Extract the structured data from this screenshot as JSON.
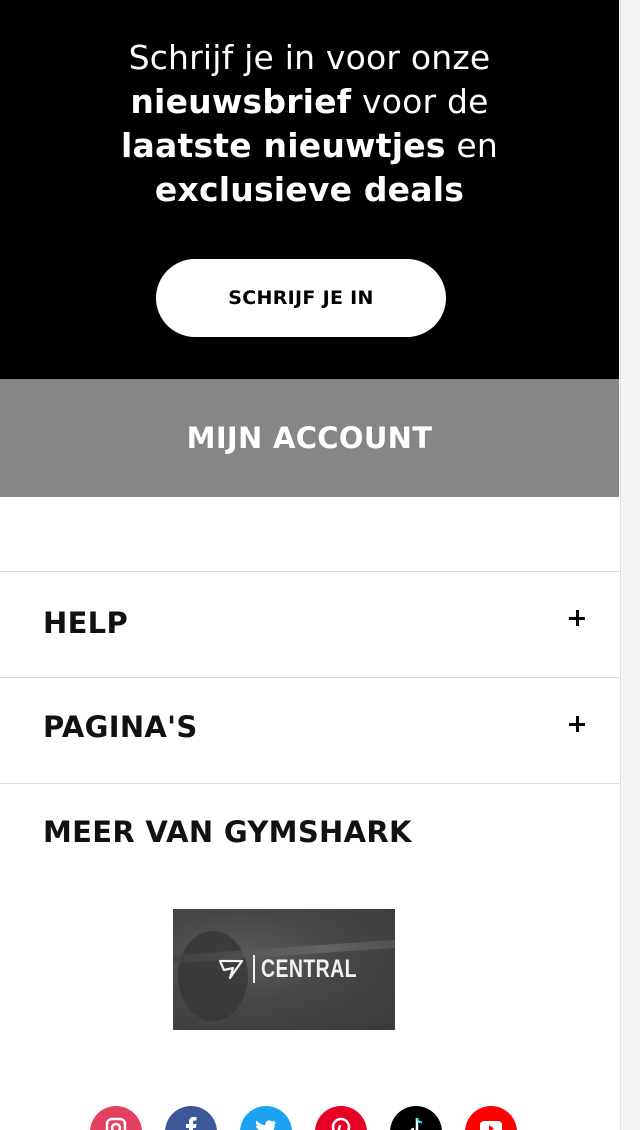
{
  "newsletter": {
    "line1": "Schrijf je in voor onze",
    "line2_bold": "nieuwsbrief",
    "line2_rest": " voor de",
    "line3_bold": "laatste nieuwtjes",
    "line3_rest": " en",
    "line4_bold": "exclusieve deals",
    "button_label": "SCHRIJF JE IN"
  },
  "account": {
    "label": "MIJN ACCOUNT"
  },
  "accordion": [
    {
      "label": "HELP",
      "icon": "plus-icon"
    },
    {
      "label": "PAGINA'S",
      "icon": "plus-icon"
    }
  ],
  "more": {
    "title": "MEER VAN GYMSHARK",
    "banner_text": "CENTRAL"
  },
  "social": [
    {
      "name": "instagram-icon",
      "color": "#e4405f"
    },
    {
      "name": "facebook-icon",
      "color": "#3b5998"
    },
    {
      "name": "twitter-icon",
      "color": "#1da1f2"
    },
    {
      "name": "pinterest-icon",
      "color": "#e60023"
    },
    {
      "name": "tiktok-icon",
      "color": "#000000"
    },
    {
      "name": "youtube-icon",
      "color": "#ff0000"
    }
  ]
}
